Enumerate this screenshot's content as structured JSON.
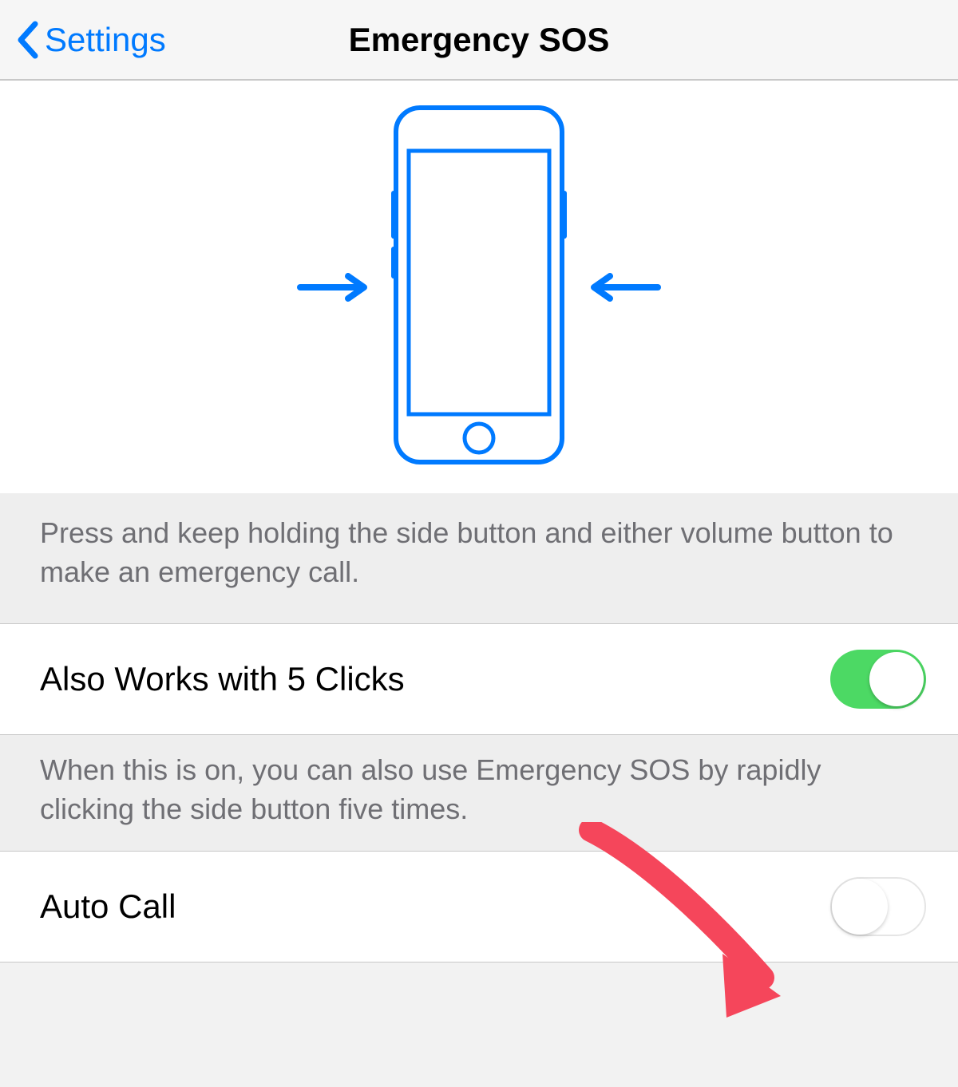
{
  "navbar": {
    "back_label": "Settings",
    "title": "Emergency SOS"
  },
  "diagram": {
    "footer": "Press and keep holding the side button and either volume button to make an emergency call."
  },
  "settings": [
    {
      "label": "Also Works with 5 Clicks",
      "enabled": true,
      "footer": "When this is on, you can also use Emergency SOS by rapidly clicking the side button five times."
    },
    {
      "label": "Auto Call",
      "enabled": false
    }
  ],
  "colors": {
    "accent": "#007aff",
    "toggle_on": "#4cd964",
    "annotation": "#f5465b"
  }
}
